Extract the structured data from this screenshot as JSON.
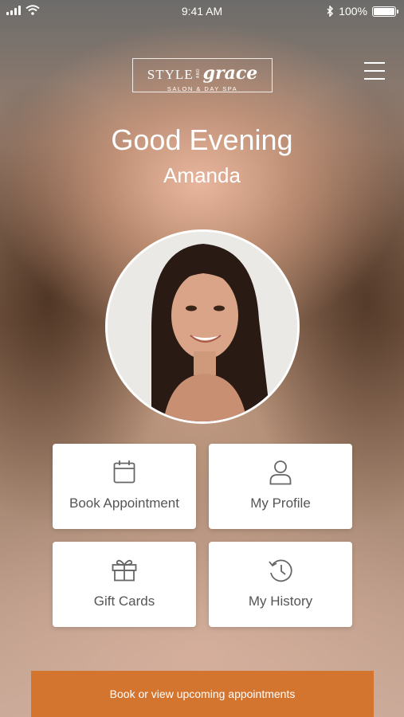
{
  "status_bar": {
    "time": "9:41 AM",
    "battery": "100%",
    "battery_level": 1.0
  },
  "logo": {
    "style": "STYLE",
    "and": "AND",
    "grace": "grace",
    "subtitle": "SALON & DAY SPA"
  },
  "greeting": "Good Evening",
  "user_name": "Amanda",
  "tiles": [
    {
      "label": "Book Appointment",
      "icon": "calendar-icon"
    },
    {
      "label": "My Profile",
      "icon": "user-icon"
    },
    {
      "label": "Gift Cards",
      "icon": "gift-icon"
    },
    {
      "label": "My History",
      "icon": "history-icon"
    }
  ],
  "bottom_bar": {
    "label": "Book or view upcoming appointments"
  },
  "colors": {
    "accent": "#d4752f",
    "tile_text": "#555555",
    "icon_stroke": "#666666"
  }
}
